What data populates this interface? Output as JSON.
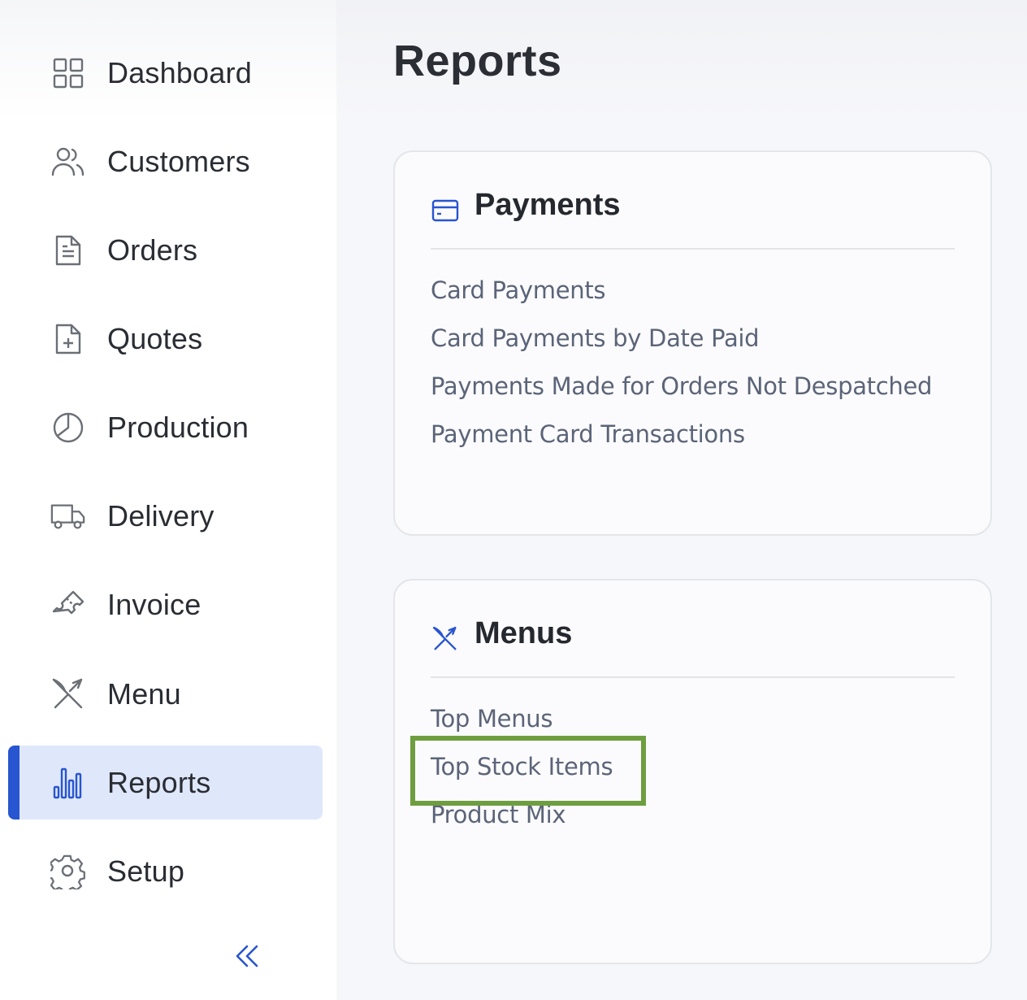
{
  "sidebar": {
    "items": [
      {
        "label": "Dashboard",
        "icon": "dashboard-grid-icon"
      },
      {
        "label": "Customers",
        "icon": "users-icon"
      },
      {
        "label": "Orders",
        "icon": "document-icon"
      },
      {
        "label": "Quotes",
        "icon": "document-plus-icon"
      },
      {
        "label": "Production",
        "icon": "pie-chart-icon"
      },
      {
        "label": "Delivery",
        "icon": "truck-icon"
      },
      {
        "label": "Invoice",
        "icon": "ticket-icon"
      },
      {
        "label": "Menu",
        "icon": "fork-knife-icon"
      },
      {
        "label": "Reports",
        "icon": "bar-chart-icon",
        "active": true
      },
      {
        "label": "Setup",
        "icon": "gear-icon"
      }
    ],
    "collapse_icon": "double-chevron-left-icon"
  },
  "main": {
    "title": "Reports",
    "cards": [
      {
        "title": "Payments",
        "icon": "credit-card-icon",
        "links": [
          "Card Payments",
          "Card Payments by Date Paid",
          "Payments Made for Orders Not Despatched",
          "Payment Card Transactions"
        ]
      },
      {
        "title": "Menus",
        "icon": "fork-knife-icon",
        "links": [
          "Top Menus",
          "Top Stock Items",
          "Product Mix"
        ]
      }
    ]
  },
  "colors": {
    "accent": "#2855d0",
    "active_bg": "#dfe8fb",
    "link": "#5b6478",
    "highlight": "#6e9e3f"
  }
}
